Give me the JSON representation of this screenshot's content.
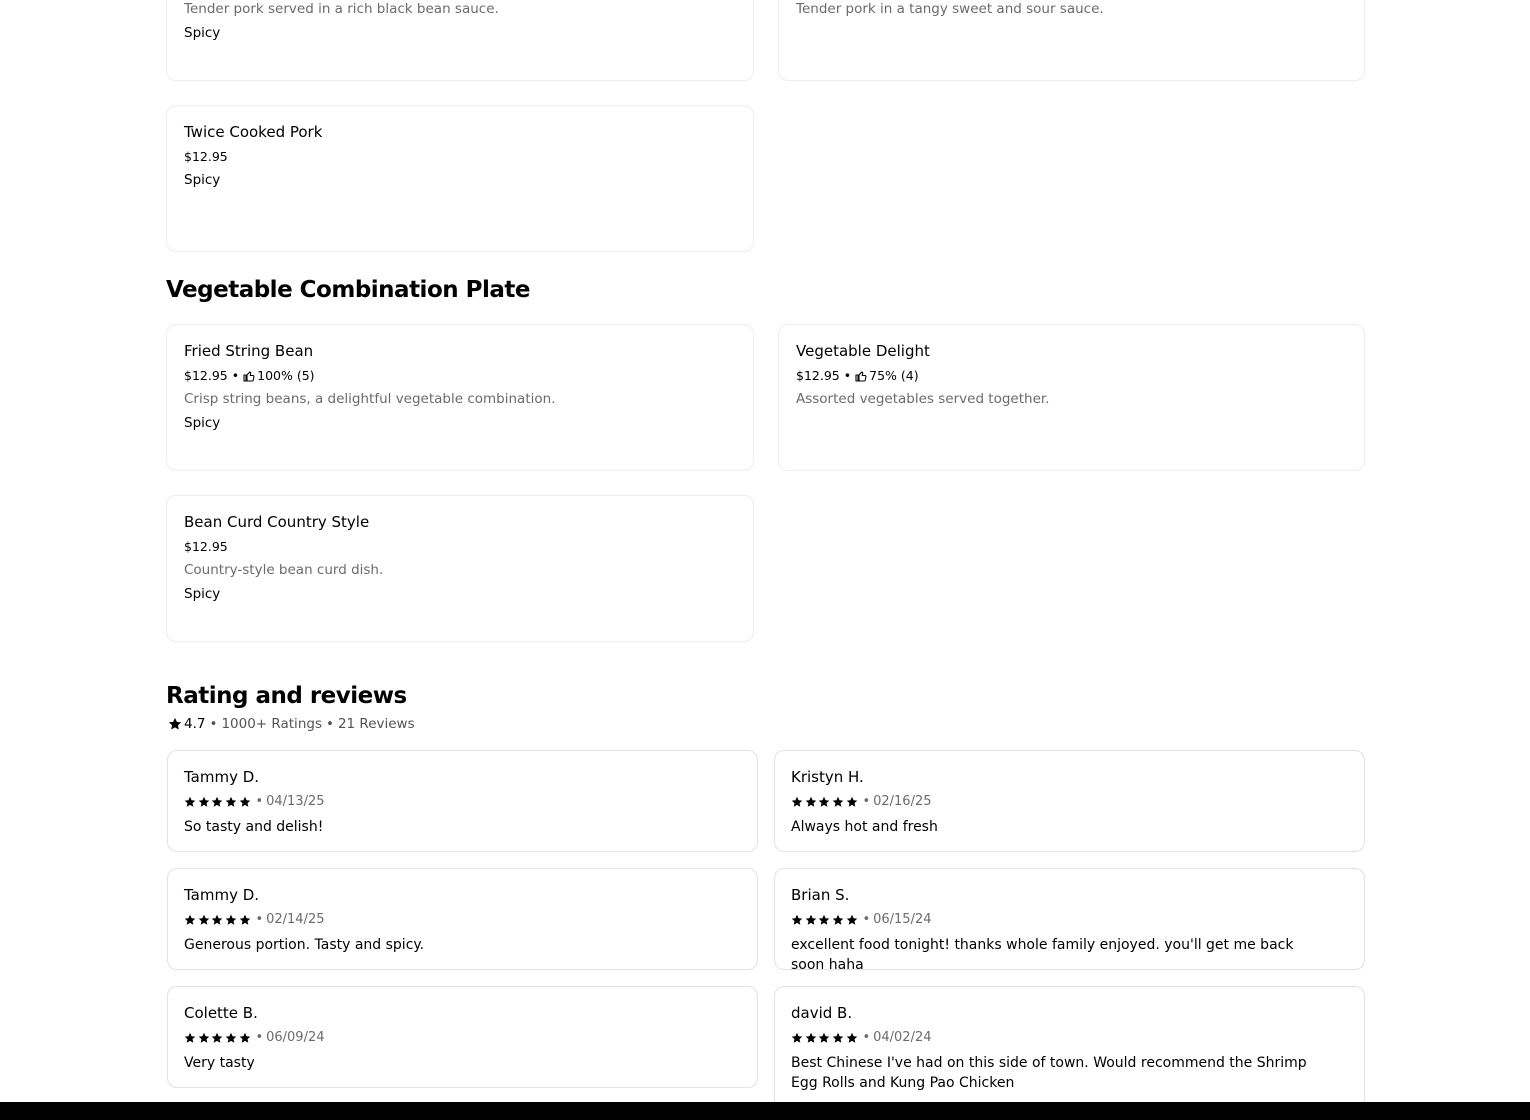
{
  "menu_cards_top": [
    {
      "description": "Tender pork served in a rich black bean sauce.",
      "tag": "Spicy"
    },
    {
      "description": "Tender pork in a tangy sweet and sour sauce."
    }
  ],
  "twice_cooked": {
    "name": "Twice Cooked Pork",
    "price": "$12.95",
    "tag": "Spicy"
  },
  "veg_section": {
    "title": "Vegetable Combination Plate",
    "items": [
      {
        "name": "Fried String Bean",
        "price": "$12.95",
        "sep": "•",
        "rating": "100% (5)",
        "description": "Crisp string beans, a delightful vegetable combination.",
        "tag": "Spicy"
      },
      {
        "name": "Vegetable Delight",
        "price": "$12.95",
        "sep": "•",
        "rating": "75% (4)",
        "description": "Assorted vegetables served together."
      },
      {
        "name": "Bean Curd Country Style",
        "price": "$12.95",
        "description": "Country-style bean curd dish.",
        "tag": "Spicy"
      }
    ]
  },
  "reviews_section": {
    "title": "Rating and reviews",
    "rating": "4.7",
    "sep": "•",
    "ratings_count": "1000+ Ratings",
    "reviews_count": "21 Reviews",
    "reviews": [
      {
        "name": "Tammy D.",
        "stars": 5,
        "date": "04/13/25",
        "text": "So tasty and delish!"
      },
      {
        "name": "Kristyn H.",
        "stars": 5,
        "date": "02/16/25",
        "text": "Always hot and fresh"
      },
      {
        "name": "Tammy D.",
        "stars": 5,
        "date": "02/14/25",
        "text": "Generous portion. Tasty and spicy."
      },
      {
        "name": "Brian S.",
        "stars": 5,
        "date": "06/15/24",
        "text": "excellent food tonight! thanks whole family enjoyed. you'll get me back soon haha"
      },
      {
        "name": "Colette B.",
        "stars": 5,
        "date": "06/09/24",
        "text": "Very tasty"
      },
      {
        "name": "david B.",
        "stars": 5,
        "date": "04/02/24",
        "text": "Best Chinese I've had on this side of town. Would recommend the Shrimp Egg Rolls and Kung Pao Chicken"
      }
    ]
  },
  "colors": {
    "muted": "#6b6b6b",
    "border": "#ededed",
    "text": "#000000"
  }
}
